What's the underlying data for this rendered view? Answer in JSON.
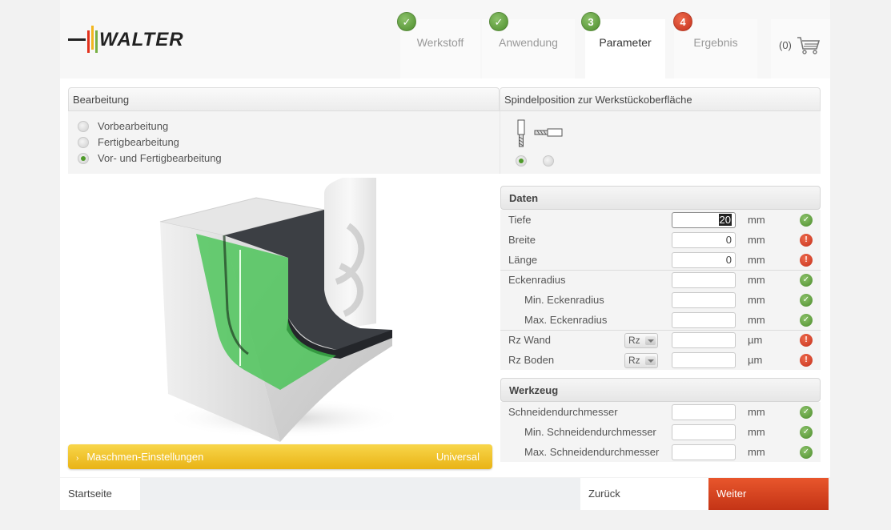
{
  "brand": {
    "logo_text": "WALTER"
  },
  "steps": [
    {
      "label": "Werkstoff",
      "badge": "✓",
      "state": "done"
    },
    {
      "label": "Anwendung",
      "badge": "✓",
      "state": "done"
    },
    {
      "label": "Parameter",
      "badge": "3",
      "state": "active"
    },
    {
      "label": "Ergebnis",
      "badge": "4",
      "state": "pending"
    }
  ],
  "cart": {
    "count": "(0)"
  },
  "bearbeitung": {
    "title": "Bearbeitung",
    "options": [
      {
        "label": "Vorbearbeitung",
        "checked": false
      },
      {
        "label": "Fertigbearbeitung",
        "checked": false
      },
      {
        "label": "Vor- und Fertigbearbeitung",
        "checked": true
      }
    ]
  },
  "spindel": {
    "title": "Spindelposition zur Werkstückoberfläche",
    "options": [
      {
        "icon": "vertical-tool-icon",
        "checked": true
      },
      {
        "icon": "horizontal-tool-icon",
        "checked": false
      }
    ]
  },
  "daten": {
    "title": "Daten",
    "rows": [
      {
        "label": "Tiefe",
        "value": "20",
        "unit": "mm",
        "status": "ok"
      },
      {
        "label": "Breite",
        "value": "0",
        "unit": "mm",
        "status": "err"
      },
      {
        "label": "Länge",
        "value": "0",
        "unit": "mm",
        "status": "err"
      },
      {
        "label": "Eckenradius",
        "value": "",
        "unit": "mm",
        "status": "ok"
      },
      {
        "label": "Min. Eckenradius",
        "value": "",
        "unit": "mm",
        "status": "ok"
      },
      {
        "label": "Max. Eckenradius",
        "value": "",
        "unit": "mm",
        "status": "ok"
      },
      {
        "label": "Rz Wand",
        "select": "Rz",
        "value": "",
        "unit": "µm",
        "status": "err"
      },
      {
        "label": "Rz Boden",
        "select": "Rz",
        "value": "",
        "unit": "µm",
        "status": "err"
      }
    ]
  },
  "werkzeug": {
    "title": "Werkzeug",
    "rows": [
      {
        "label": "Schneidendurchmesser",
        "value": "",
        "unit": "mm",
        "status": "ok"
      },
      {
        "label": "Min. Schneidendurchmesser",
        "value": "",
        "unit": "mm",
        "status": "ok"
      },
      {
        "label": "Max. Schneidendurchmesser",
        "value": "",
        "unit": "mm",
        "status": "ok"
      }
    ]
  },
  "machine": {
    "label": "Maschmen-Einstellungen",
    "value": "Universal",
    "arrow": "›"
  },
  "nav": {
    "home": "Startseite",
    "back": "Zurück",
    "next": "Weiter"
  },
  "status_icons": {
    "ok": "✓",
    "err": "!"
  },
  "colors": {
    "accent_green": "#4e9a2a",
    "error_red": "#d23a1f",
    "machine_yellow": "#efc224",
    "next_orange": "#d8431f"
  }
}
